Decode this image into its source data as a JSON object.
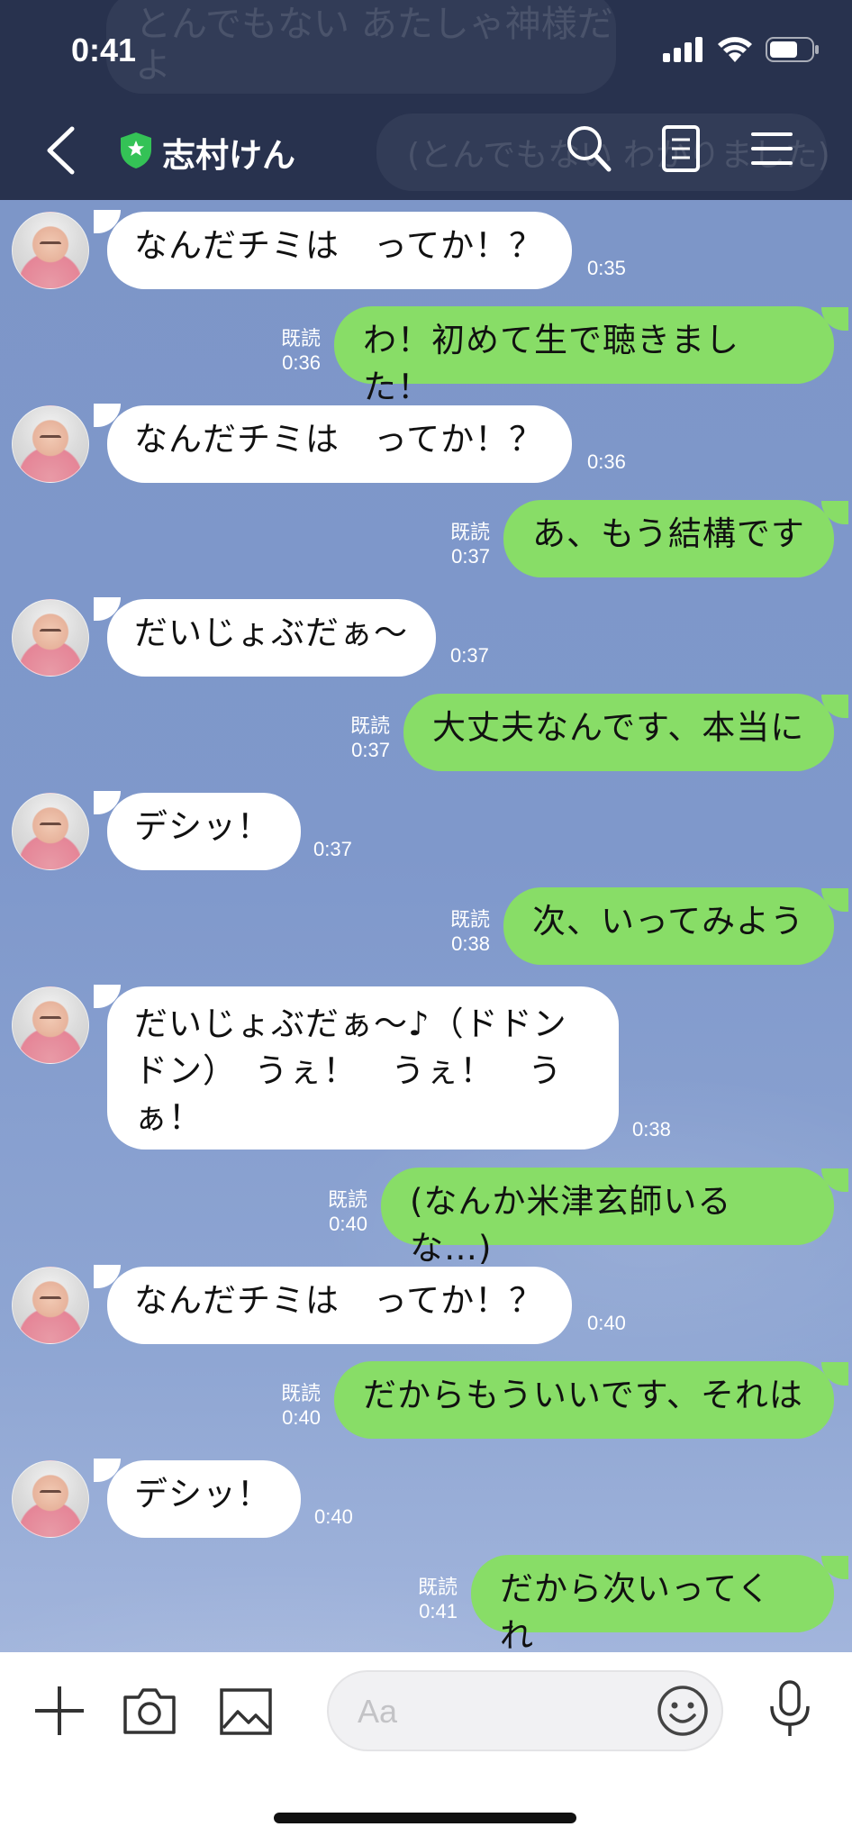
{
  "status_bar": {
    "time": "0:41"
  },
  "header": {
    "title": "志村けん",
    "ghost_texts": [
      "とんでもない あたしゃ神様だ",
      "よ",
      "(とんでもない わかりました)"
    ]
  },
  "messages": [
    {
      "side": "in",
      "text": "なんだチミは　ってか！？",
      "time": "0:35"
    },
    {
      "side": "out",
      "text": "わ！初めて生で聴きました！",
      "read": "既読",
      "time": "0:36"
    },
    {
      "side": "in",
      "text": "なんだチミは　ってか！？",
      "time": "0:36"
    },
    {
      "side": "out",
      "text": "あ、もう結構です",
      "read": "既読",
      "time": "0:37"
    },
    {
      "side": "in",
      "text": "だいじょぶだぁ〜",
      "time": "0:37"
    },
    {
      "side": "out",
      "text": "大丈夫なんです、本当に",
      "read": "既読",
      "time": "0:37"
    },
    {
      "side": "in",
      "text": "デシッ！",
      "time": "0:37"
    },
    {
      "side": "out",
      "text": "次、いってみよう",
      "read": "既読",
      "time": "0:38"
    },
    {
      "side": "in",
      "lines": [
        "だいじょぶだぁ〜♪（ドドン",
        "ドン）　うぇ！　うぇ！　う",
        "ぁ！"
      ],
      "time": "0:38"
    },
    {
      "side": "out",
      "text": "(なんか米津玄師いるな…)",
      "read": "既読",
      "time": "0:40"
    },
    {
      "side": "in",
      "text": "なんだチミは　ってか！？",
      "time": "0:40"
    },
    {
      "side": "out",
      "text": "だからもういいです、それは",
      "read": "既読",
      "time": "0:40"
    },
    {
      "side": "in",
      "text": "デシッ！",
      "time": "0:40"
    },
    {
      "side": "out",
      "text": "だから次いってくれ",
      "read": "既読",
      "time": "0:41"
    }
  ],
  "footer": {
    "input_placeholder": "Aa"
  },
  "colors": {
    "header_bg": "#28324e",
    "bubble_out": "#88dd67",
    "bubble_in": "#ffffff",
    "chat_bg": "#7f98c9"
  },
  "icons": [
    "chevron-left-icon",
    "verified-shield-icon",
    "search-icon",
    "notes-icon",
    "menu-icon",
    "plus-icon",
    "camera-icon",
    "image-icon",
    "emoji-icon",
    "microphone-icon"
  ]
}
